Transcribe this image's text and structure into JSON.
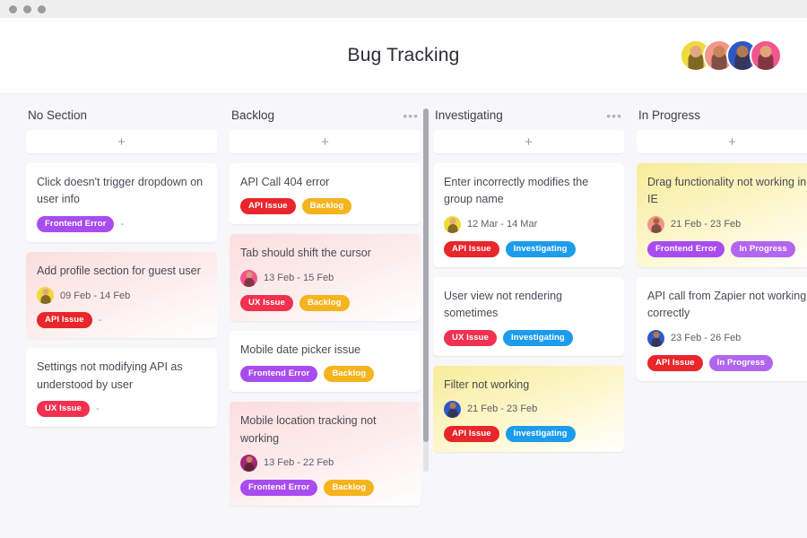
{
  "window": {
    "dots": [
      "minimize",
      "maximize",
      "close"
    ]
  },
  "header": {
    "title": "Bug Tracking",
    "avatars": [
      {
        "name": "avatar-1",
        "bg": "#f0d93b",
        "skin": "#e0a882"
      },
      {
        "name": "avatar-2",
        "bg": "#f2968a",
        "skin": "#c98559"
      },
      {
        "name": "avatar-3",
        "bg": "#2f58c4",
        "skin": "#b5794f"
      },
      {
        "name": "avatar-4",
        "bg": "#f2558c",
        "skin": "#e2a578"
      }
    ]
  },
  "tag_colors": {
    "Frontend Error": "#a84cf0",
    "API Issue": "#e8262b",
    "UX Issue": "#f0314f",
    "Backlog": "#f5b41d",
    "Investigating": "#1e9ceb",
    "In Progress": "#b266ef"
  },
  "board": {
    "add_card_label": "+",
    "menu_label": "•••",
    "columns": [
      {
        "id": "no-section",
        "title": "No Section",
        "has_menu": false,
        "has_scrollbar": false,
        "cards": [
          {
            "title": "Click doesn't trigger dropdown on user info",
            "tint": "",
            "avatar": null,
            "date": "",
            "tags": [
              "Frontend Error"
            ],
            "trailing_dash": "-"
          },
          {
            "title": "Add profile section for guest user",
            "tint": "pink",
            "avatar": {
              "bg": "#f0d93b",
              "skin": "#e0a882"
            },
            "date": "09 Feb - 14 Feb",
            "tags": [
              "API Issue"
            ],
            "trailing_dash": "-"
          },
          {
            "title": "Settings not modifying API as understood by user",
            "tint": "",
            "avatar": null,
            "date": "",
            "tags": [
              "UX Issue"
            ],
            "trailing_dash": "-"
          }
        ]
      },
      {
        "id": "backlog",
        "title": "Backlog",
        "has_menu": true,
        "has_scrollbar": true,
        "cards": [
          {
            "title": "API Call 404 error",
            "tint": "",
            "avatar": null,
            "date": "",
            "tags": [
              "API Issue",
              "Backlog"
            ],
            "trailing_dash": ""
          },
          {
            "title": "Tab should shift the cursor",
            "tint": "pink",
            "avatar": {
              "bg": "#f2558c",
              "skin": "#d99a74"
            },
            "date": "13 Feb - 15 Feb",
            "tags": [
              "UX Issue",
              "Backlog"
            ],
            "trailing_dash": ""
          },
          {
            "title": "Mobile date picker issue",
            "tint": "",
            "avatar": null,
            "date": "",
            "tags": [
              "Frontend Error",
              "Backlog"
            ],
            "trailing_dash": ""
          },
          {
            "title": "Mobile location tracking not working",
            "tint": "pink",
            "avatar": {
              "bg": "#a3277a",
              "skin": "#c98559"
            },
            "date": "13 Feb - 22 Feb",
            "tags": [
              "Frontend Error",
              "Backlog"
            ],
            "trailing_dash": ""
          }
        ]
      },
      {
        "id": "investigating",
        "title": "Investigating",
        "has_menu": true,
        "has_scrollbar": false,
        "cards": [
          {
            "title": "Enter incorrectly modifies the group name",
            "tint": "",
            "avatar": {
              "bg": "#f0d93b",
              "skin": "#e0a882"
            },
            "date": "12 Mar - 14 Mar",
            "tags": [
              "API Issue",
              "Investigating"
            ],
            "trailing_dash": ""
          },
          {
            "title": "User view not rendering sometimes",
            "tint": "",
            "avatar": null,
            "date": "",
            "tags": [
              "UX Issue",
              "Investigating"
            ],
            "trailing_dash": ""
          },
          {
            "title": "Filter not working",
            "tint": "yellow",
            "avatar": {
              "bg": "#2f58c4",
              "skin": "#b5794f"
            },
            "date": "21 Feb - 23 Feb",
            "tags": [
              "API Issue",
              "Investigating"
            ],
            "trailing_dash": ""
          }
        ]
      },
      {
        "id": "in-progress",
        "title": "In Progress",
        "has_menu": true,
        "has_scrollbar": false,
        "cards": [
          {
            "title": "Drag functionality not working in IE",
            "tint": "yellow",
            "avatar": {
              "bg": "#f2968a",
              "skin": "#a9663c"
            },
            "date": "21 Feb - 23 Feb",
            "tags": [
              "Frontend Error",
              "In Progress"
            ],
            "trailing_dash": ""
          },
          {
            "title": "API call from Zapier not working correctly",
            "tint": "",
            "avatar": {
              "bg": "#2f58c4",
              "skin": "#b5794f"
            },
            "date": "23 Feb - 26 Feb",
            "tags": [
              "API Issue",
              "In Progress"
            ],
            "trailing_dash": ""
          }
        ]
      }
    ]
  }
}
